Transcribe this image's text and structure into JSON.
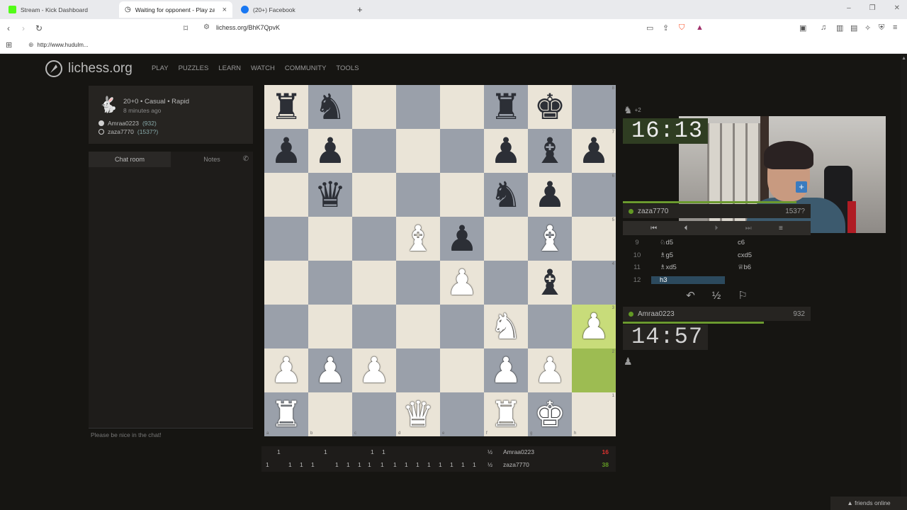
{
  "browser": {
    "tabs": [
      {
        "title": "Stream - Kick Dashboard",
        "color": "#53fc18"
      },
      {
        "title": "Waiting for opponent - Play zaza",
        "color": "#444444"
      },
      {
        "title": "(20+) Facebook",
        "color": "#1877f2"
      }
    ],
    "url": "lichess.org/BhK7QpvK",
    "bookmark": "http://www.hudulm..."
  },
  "site": {
    "logo": "lichess.org",
    "nav": [
      "PLAY",
      "PUZZLES",
      "LEARN",
      "WATCH",
      "COMMUNITY",
      "TOOLS"
    ]
  },
  "game_info": {
    "title": "20+0 • Casual • Rapid",
    "time_ago": "8 minutes ago",
    "players": [
      {
        "name": "Amraa0223",
        "rating": "(932)",
        "color": "white"
      },
      {
        "name": "zaza7770",
        "rating": "(1537?)",
        "color": "black"
      }
    ]
  },
  "chat": {
    "tabs": [
      "Chat room",
      "Notes"
    ],
    "placeholder": "Please be nice in the chat!"
  },
  "board": {
    "ranks": [
      [
        "bR",
        "bN",
        "",
        "",
        "",
        "bR",
        "bK",
        ""
      ],
      [
        "bP",
        "bP",
        "",
        "",
        "",
        "bP",
        "bB",
        "bP"
      ],
      [
        "",
        "bQ",
        "",
        "",
        "",
        "bN",
        "bP",
        ""
      ],
      [
        "",
        "",
        "",
        "wB",
        "bP",
        "",
        "wB",
        ""
      ],
      [
        "",
        "",
        "",
        "",
        "wP",
        "",
        "bB",
        ""
      ],
      [
        "",
        "",
        "",
        "",
        "",
        "wN",
        "",
        "wP"
      ],
      [
        "wP",
        "wP",
        "wP",
        "",
        "",
        "wP",
        "wP",
        ""
      ],
      [
        "wR",
        "",
        "",
        "wQ",
        "",
        "wR",
        "wK",
        ""
      ]
    ],
    "highlight": [
      [
        5,
        7
      ],
      [
        6,
        7
      ]
    ],
    "rank_labels": [
      "8",
      "7",
      "6",
      "5",
      "4",
      "3",
      "2",
      "1"
    ],
    "file_labels": [
      "a",
      "b",
      "c",
      "d",
      "e",
      "f",
      "g",
      "h"
    ]
  },
  "right_panel": {
    "top_plus": "+2",
    "top_clock": "16:13",
    "top_player": {
      "name": "zaza7770",
      "rating": "1537?"
    },
    "bottom_clock": "14:57",
    "bottom_player": {
      "name": "Amraa0223",
      "rating": "932"
    },
    "moves": [
      {
        "no": "9",
        "w": "♘d5",
        "b": "c6"
      },
      {
        "no": "10",
        "w": "♗g5",
        "b": "cxd5"
      },
      {
        "no": "11",
        "w": "♗xd5",
        "b": "♕b6"
      },
      {
        "no": "12",
        "w": "h3",
        "b": ""
      }
    ],
    "controls": [
      "⏮",
      "⏴",
      "⏵",
      "⏭",
      "≡"
    ],
    "game_actions": [
      "↶",
      "½",
      "⚐"
    ]
  },
  "scores": {
    "row1": {
      "marks": [
        "1",
        "1",
        "1",
        "1"
      ],
      "half": "½",
      "name": "Amraa0223",
      "total": "16",
      "total_color": "#dc322f"
    },
    "row2": {
      "marks": [
        "1",
        "1",
        "1",
        "1",
        "1",
        "1",
        "1",
        "1",
        "1",
        "1",
        "1",
        "1",
        "1",
        "1",
        "1",
        "1",
        "1"
      ],
      "half": "½",
      "name": "zaza7770",
      "total": "38",
      "total_color": "#629924"
    }
  },
  "footer": {
    "friends": "▲ friends online"
  }
}
